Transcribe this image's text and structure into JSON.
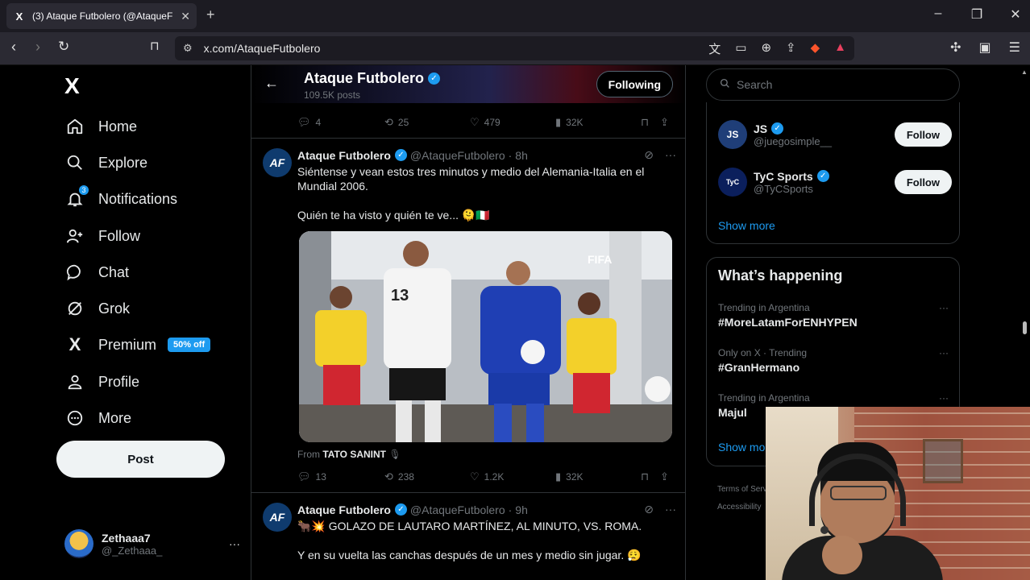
{
  "browser": {
    "tab_title": "(3) Ataque Futbolero (@AtaqueF",
    "tab_favicon": "X",
    "new_tab": "+",
    "url": "x.com/AtaqueFutbolero",
    "win_min": "–",
    "win_restore": "❐",
    "win_close": "✕"
  },
  "sidebar": {
    "logo": "X",
    "nav": [
      {
        "label": "Home",
        "icon": "home-icon"
      },
      {
        "label": "Explore",
        "icon": "search-icon"
      },
      {
        "label": "Notifications",
        "icon": "bell-icon",
        "badge": "3"
      },
      {
        "label": "Follow",
        "icon": "person-add-icon"
      },
      {
        "label": "Chat",
        "icon": "chat-icon"
      },
      {
        "label": "Grok",
        "icon": "grok-icon"
      },
      {
        "label": "Premium",
        "icon": "x-icon",
        "badge_text": "50% off"
      },
      {
        "label": "Profile",
        "icon": "person-icon"
      },
      {
        "label": "More",
        "icon": "more-circle-icon"
      }
    ],
    "post_label": "Post",
    "account": {
      "name": "Zethaaa7",
      "handle": "@_Zethaaa_",
      "more": "···"
    }
  },
  "header": {
    "name": "Ataque Futbolero",
    "posts": "109.5K posts",
    "following_label": "Following"
  },
  "tweets": [
    {
      "stats": {
        "replies": "4",
        "reposts": "25",
        "likes": "479",
        "views": "32K"
      }
    },
    {
      "avatar": "AF",
      "name": "Ataque Futbolero",
      "handle": "@AtaqueFutbolero",
      "time": "8h",
      "text1": "Siéntense y vean estos tres minutos y medio del Alemania-Italia en el Mundial 2006.",
      "text2": "Quién te ha visto y quién te ve... 🫠🇮🇹",
      "media_watermark": "FIFA",
      "media_jersey": "13",
      "from_prefix": "From",
      "from_name": "TATO SANINT",
      "stats": {
        "replies": "13",
        "reposts": "238",
        "likes": "1.2K",
        "views": "32K"
      }
    },
    {
      "avatar": "AF",
      "name": "Ataque Futbolero",
      "handle": "@AtaqueFutbolero",
      "time": "9h",
      "text1": "🐂💥 GOLAZO DE LAUTARO MARTÍNEZ, AL MINUTO, VS. ROMA.",
      "text2": "Y en su vuelta las canchas después de un mes y medio sin jugar. 😮‍💨"
    }
  ],
  "right": {
    "search_placeholder": "Search",
    "who_to_follow": [
      {
        "name": "JS",
        "handle": "@juegosimple__",
        "button": "Follow",
        "avatar": "JS",
        "avatar_color": "#1f3e78"
      },
      {
        "name": "TyC Sports",
        "handle": "@TyCSports",
        "button": "Follow",
        "avatar": "TyC",
        "avatar_color": "#0b1f5c"
      }
    ],
    "show_more": "Show more",
    "whats_happening": "What’s happening",
    "trends": [
      {
        "context": "Trending in Argentina",
        "name": "#MoreLatamForENHYPEN"
      },
      {
        "context": "Only on X · Trending",
        "name": "#GranHermano"
      },
      {
        "context": "Trending in Argentina",
        "name": "Majul"
      }
    ],
    "show_more_2": "Show more",
    "footer_1": "Terms of Service",
    "footer_2": "Accessibility"
  },
  "colors": {
    "accent": "#1d9bf0",
    "background": "#000000",
    "border": "#2f3336",
    "muted": "#71767b"
  }
}
